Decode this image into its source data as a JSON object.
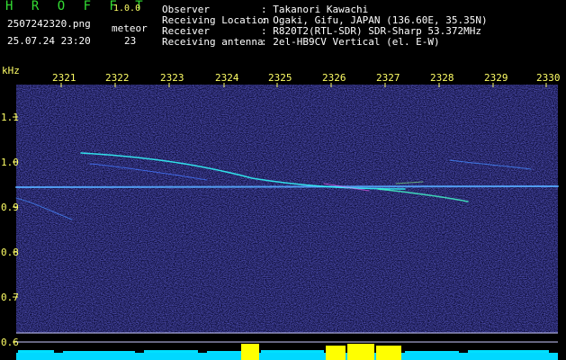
{
  "header": {
    "logo": "H R O F F T",
    "version": "1.0.0",
    "filename": "2507242320.png",
    "datetime": "25.07.24 23:20",
    "meteor_label": "meteor",
    "meteor_count": "23",
    "info": [
      {
        "label": "Observer",
        "value": ": Takanori Kawachi"
      },
      {
        "label": "Receiving Location",
        "value": ": Ogaki, Gifu, JAPAN (136.60E, 35.35N)"
      },
      {
        "label": "Receiver",
        "value": ": R820T2(RTL-SDR) SDR-Sharp 53.372MHz"
      },
      {
        "label": "Receiving antenna",
        "value": ": 2el-HB9CV Vertical (el. E-W)"
      }
    ]
  },
  "axes": {
    "y_unit": "kHz",
    "x_ticks": [
      "2321",
      "2322",
      "2323",
      "2324",
      "2325",
      "2326",
      "2327",
      "2328",
      "2329",
      "2330"
    ],
    "y_ticks": [
      "1.1",
      "1.0",
      "0.9",
      "0.8",
      "0.7",
      "0.6"
    ]
  },
  "colors": {
    "background": "#000000",
    "noise": "#1a1a8a",
    "tick_text": "#ffff66",
    "signal": "#33ffff",
    "spectrum": "#00ffff",
    "burst": "#ffff00"
  }
}
